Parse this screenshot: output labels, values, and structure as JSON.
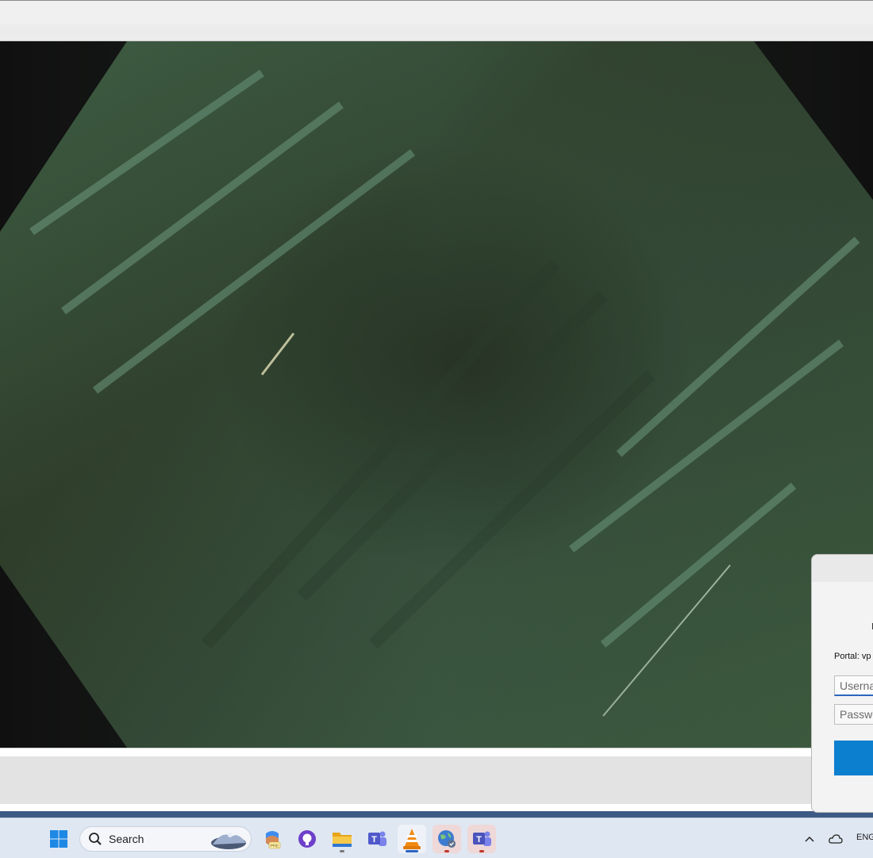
{
  "window": {
    "title": ""
  },
  "video": {
    "description_icon": "video-frame"
  },
  "dialog": {
    "portal_label": "Portal: vp",
    "username_placeholder": "Userna",
    "password_placeholder": "Passwo",
    "connect_label": ""
  },
  "taskbar": {
    "search_placeholder": "Search",
    "apps": [
      {
        "icon": "windows-start-icon"
      },
      {
        "icon": "copilot-icon"
      },
      {
        "icon": "github-desktop-icon"
      },
      {
        "icon": "file-explorer-icon"
      },
      {
        "icon": "teams-icon"
      },
      {
        "icon": "vlc-icon"
      },
      {
        "icon": "globe-vpn-icon"
      },
      {
        "icon": "teams-alt-icon"
      }
    ],
    "tray": {
      "language": "ENG"
    }
  },
  "colors": {
    "accent": "#0d7fcf",
    "taskbar_bg": "#dfe7f2",
    "dialog_bg": "#f3f3f3"
  }
}
